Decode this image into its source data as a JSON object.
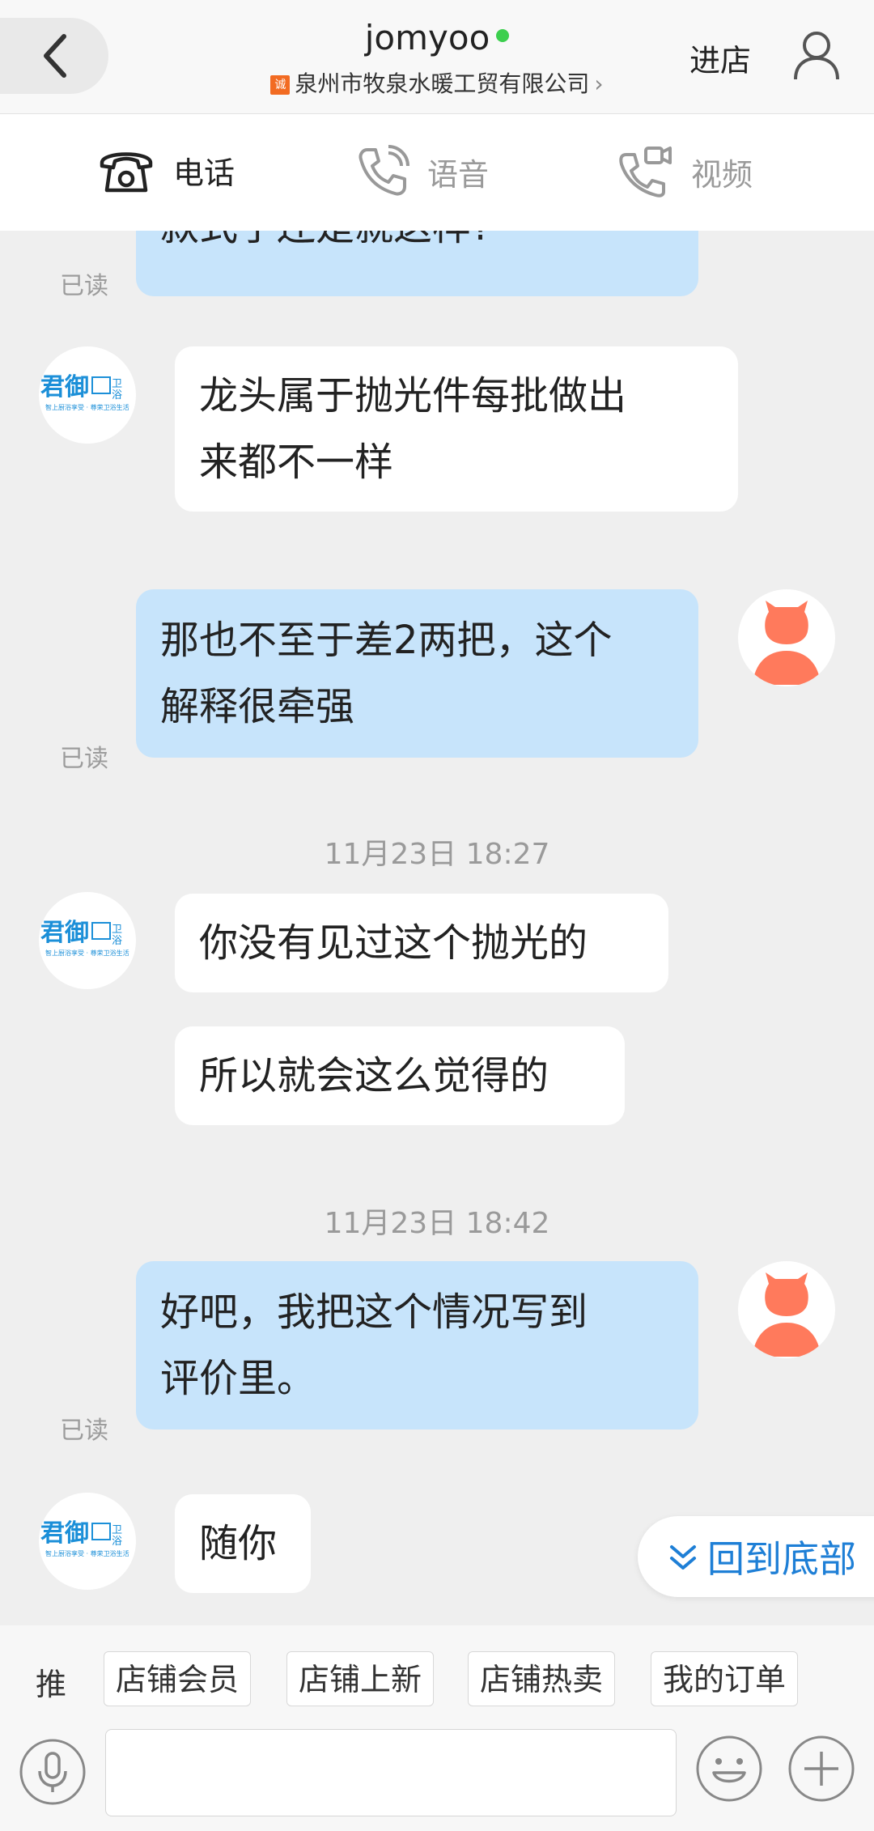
{
  "header": {
    "title": "jomyoo",
    "store_badge": "诚",
    "company": "泉州市牧泉水暖工贸有限公司",
    "enter_store": "进店"
  },
  "call_bar": {
    "phone": "电话",
    "voice": "语音",
    "video": "视频"
  },
  "messages": [
    {
      "side": "out",
      "text": "款式了还是就这样?",
      "read": "已读"
    },
    {
      "side": "in",
      "lines": [
        "龙头属于抛光件每批做出",
        "来都不一样"
      ]
    },
    {
      "side": "out",
      "lines": [
        "那也不至于差2两把，这个",
        "解释很牵强"
      ],
      "read": "已读"
    },
    {
      "timestamp": "11月23日 18:27"
    },
    {
      "side": "in",
      "text": "你没有见过这个抛光的"
    },
    {
      "side": "in",
      "text": "所以就会这么觉得的"
    },
    {
      "timestamp": "11月23日 18:42"
    },
    {
      "side": "out",
      "lines": [
        "好吧，我把这个情况写到",
        "评价里。"
      ],
      "read": "已读"
    },
    {
      "side": "in",
      "text": "随你"
    }
  ],
  "shop_logo": {
    "brand": "君御",
    "suffix": "卫浴",
    "tagline": "智上厨浴享受 · 尊荣卫浴生活"
  },
  "back_to_bottom": "回到底部",
  "quick_bar": {
    "label": "推",
    "chips": [
      "店铺会员",
      "店铺上新",
      "店铺热卖",
      "我的订单"
    ]
  },
  "colors": {
    "outgoing_bubble": "#c7e4fb",
    "incoming_bubble": "#ffffff",
    "accent_link": "#1e7fd6",
    "online_dot": "#3ccf4e",
    "avatar_orange": "#ff7a5c"
  }
}
